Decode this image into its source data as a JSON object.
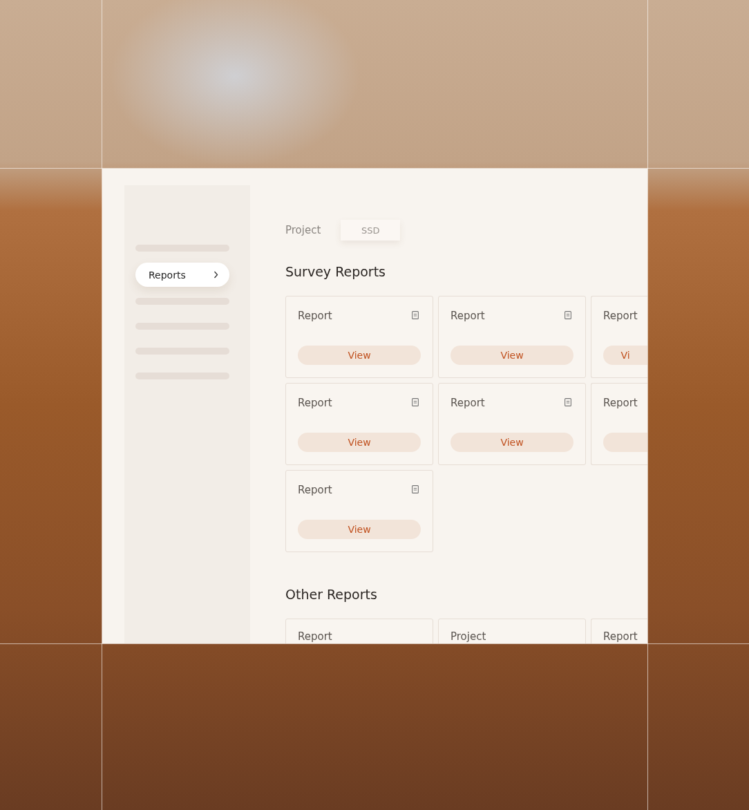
{
  "sidebar": {
    "items": [
      {
        "kind": "placeholder",
        "selected": false
      },
      {
        "kind": "link",
        "label": "Reports",
        "selected": true
      },
      {
        "kind": "placeholder",
        "selected": false
      },
      {
        "kind": "placeholder",
        "selected": false
      },
      {
        "kind": "placeholder",
        "selected": false
      },
      {
        "kind": "placeholder",
        "selected": false
      }
    ]
  },
  "breadcrumb": {
    "label": "Project",
    "chip": "SSD"
  },
  "sections": [
    {
      "title": "Survey Reports",
      "cards": [
        {
          "kind": "action",
          "title": "Report",
          "icon": true,
          "button_label": "View"
        },
        {
          "kind": "action",
          "title": "Report",
          "icon": true,
          "button_label": "View"
        },
        {
          "kind": "action",
          "title": "Report",
          "icon": false,
          "button_label": "Vi"
        },
        {
          "kind": "action",
          "title": "Report",
          "icon": true,
          "button_label": "View"
        },
        {
          "kind": "action",
          "title": "Report",
          "icon": true,
          "button_label": "View"
        },
        {
          "kind": "action",
          "title": "Report",
          "icon": false
        },
        {
          "kind": "action",
          "title": "Report",
          "icon": true,
          "button_label": "View"
        }
      ]
    },
    {
      "title": "Other Reports",
      "cards": [
        {
          "kind": "plain",
          "title": "Report",
          "icon": false
        },
        {
          "kind": "plain",
          "title": "Project",
          "icon": false
        },
        {
          "kind": "plain",
          "title": "Report",
          "icon": false
        }
      ]
    }
  ]
}
